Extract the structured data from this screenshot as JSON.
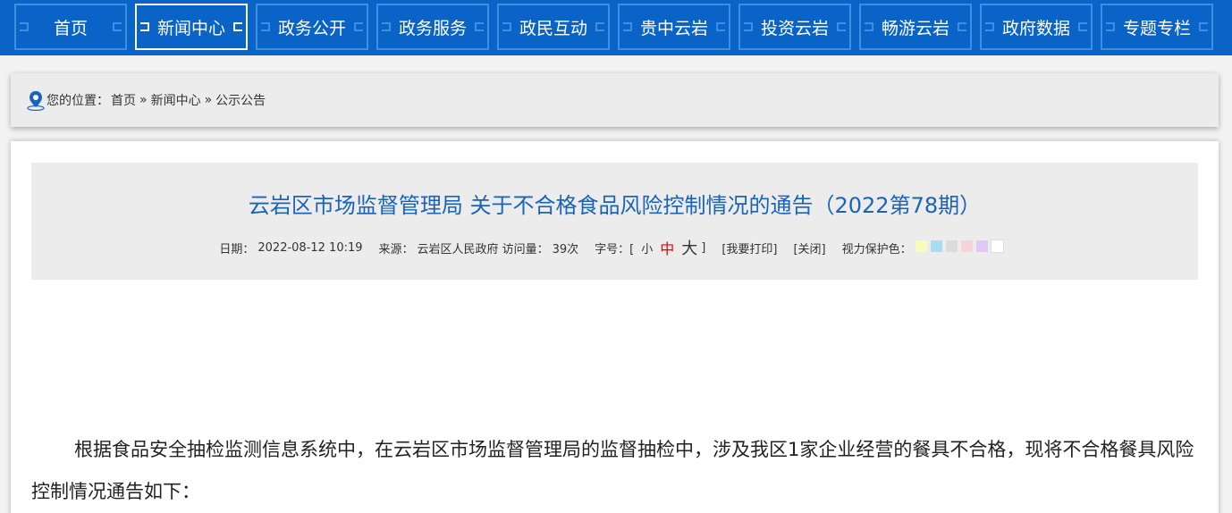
{
  "nav": {
    "items": [
      "首页",
      "新闻中心",
      "政务公开",
      "政务服务",
      "政民互动",
      "贵中云岩",
      "投资云岩",
      "畅游云岩",
      "政府数据",
      "专题专栏"
    ],
    "active_index": 1,
    "bg_color": "#0a63c6"
  },
  "breadcrumb": {
    "prefix": "您的位置：",
    "home": "首页",
    "sep1": "»",
    "section": "新闻中心",
    "sep2": "»",
    "current": "公示公告"
  },
  "article": {
    "title": "云岩区市场监督管理局 关于不合格食品风险控制情况的通告（2022第78期）",
    "date_label": "日期：",
    "date": "2022-08-12 10:19",
    "source_label": "来源：",
    "source": "云岩区人民政府",
    "visits_label": "访问量：",
    "visits": "39次",
    "fontsize_label": "字号：[",
    "fs_small": "小",
    "fs_mid": "中",
    "fs_large": "大",
    "fontsize_close": "]",
    "print": "[我要打印]",
    "close": "[关闭]",
    "eye_label": "视力保护色：",
    "eye_colors": [
      "#fafabe",
      "#a8dcf2",
      "#dcdcdc",
      "#f8d3dc",
      "#e0c8f7",
      "#ffffff"
    ],
    "paragraph": "根据食品安全抽检监测信息系统中，在云岩区市场监督管理局的监督抽检中，涉及我区1家企业经营的餐具不合格，现将不合格餐具风险控制情况通告如下："
  }
}
